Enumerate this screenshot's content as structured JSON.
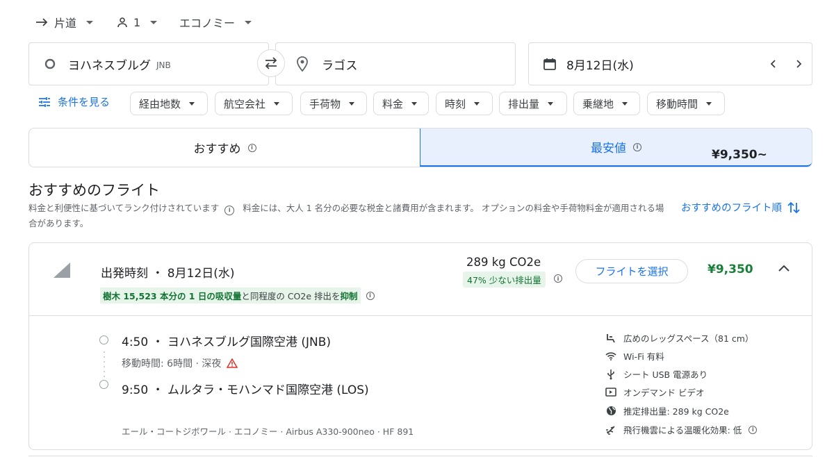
{
  "search": {
    "trip_type": "片道",
    "passengers": "1",
    "cabin_class": "エコノミー",
    "origin_city": "ヨハネスブルグ",
    "origin_code": "JNB",
    "destination": "ラゴス",
    "date": "8月12日(水)"
  },
  "filters": {
    "show_filters_label": "条件を見る",
    "chips": [
      "経由地数",
      "航空会社",
      "手荷物",
      "料金",
      "時刻",
      "排出量",
      "乗継地",
      "移動時間"
    ]
  },
  "tabs": {
    "recommended": "おすすめ",
    "cheapest": "最安値",
    "cheapest_price": "¥9,350~"
  },
  "results": {
    "heading": "おすすめのフライト",
    "description_1": "料金と利便性に基づいてランク付けされています",
    "description_2": "料金には、大人 1 名分の必要な税金と諸費用が含まれます。 オプションの料金や手荷物料金が適用される場合があります。",
    "sort_label": "おすすめのフライト順"
  },
  "flight": {
    "departure_label": "出発時刻 ・ 8月12日(水)",
    "co2_highlight_1": "樹木 15,523 本分の 1 日の吸収量",
    "co2_middle": "と同程度の CO2e 排出を",
    "co2_highlight_2": "抑制",
    "emissions": "289 kg CO2e",
    "emissions_badge": "47% 少ない排出量",
    "select_label": "フライトを選択",
    "price": "¥9,350",
    "dep_time_airport": "4:50 ・ ヨハネスブルグ国際空港 (JNB)",
    "duration": "移動時間: 6時間 · 深夜",
    "arr_time_airport": "9:50 ・ ムルタラ・モハンマド国際空港 (LOS)",
    "airline_info": "エール・コートジボワール · エコノミー · Airbus A330-900neo · HF 891",
    "amenities": [
      {
        "icon": "legroom-icon",
        "label": "広めのレッグスペース（81 cm）"
      },
      {
        "icon": "wifi-icon",
        "label": "Wi-Fi 有料"
      },
      {
        "icon": "usb-icon",
        "label": "シート USB 電源あり"
      },
      {
        "icon": "video-icon",
        "label": "オンデマンド ビデオ"
      },
      {
        "icon": "globe-icon",
        "label": "推定排出量: 289 kg CO2e"
      },
      {
        "icon": "contrail-icon",
        "label": "飛行機雲による温暖化効果: 低"
      }
    ]
  },
  "colors": {
    "accent": "#1a73e8",
    "price_green": "#188038",
    "badge_bg": "#e6f4ea",
    "border": "#dadce0"
  }
}
